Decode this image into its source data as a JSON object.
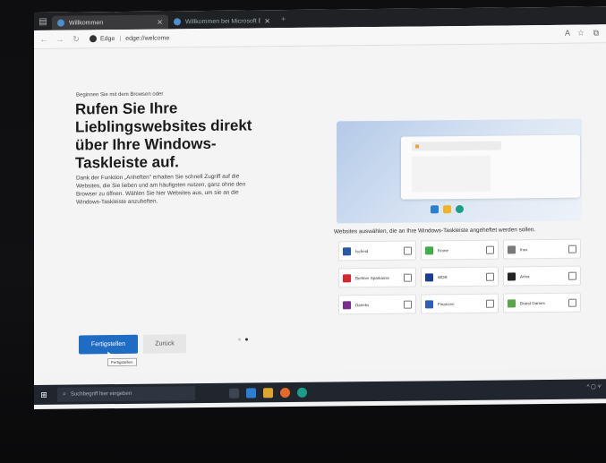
{
  "browser": {
    "tabs": [
      {
        "title": "Willkommen",
        "active": true
      },
      {
        "title": "Willkommen bei Microsoft Edge",
        "active": false
      }
    ],
    "address": {
      "label": "Edge",
      "url": "edge://welcome"
    }
  },
  "page": {
    "kicker": "Beginnen Sie mit dem Browsen oder",
    "heading": "Rufen Sie Ihre Lieblingswebsites direkt über Ihre Windows-Taskleiste auf.",
    "description": "Dank der Funktion „Anheften\" erhalten Sie schnell Zugriff auf die Websites, die Sie lieben und am häufigsten nutzen, ganz ohne den Browser zu öffnen. Wählen Sie hier Websites aus, um sie an die Windows-Taskleiste anzuheften.",
    "sites_title": "Websites auswählen, die an Ihre Windows-Taskleiste angeheftet werden sollen.",
    "sites": [
      {
        "name": "Ischeid",
        "color": "#2a56a8"
      },
      {
        "name": "Krone",
        "color": "#3fae49"
      },
      {
        "name": "Inux",
        "color": "#7a7a7a"
      },
      {
        "name": "Berliner Sparkasse",
        "color": "#d8262d"
      },
      {
        "name": "WDR",
        "color": "#1a3d8f"
      },
      {
        "name": "Arina",
        "color": "#222222"
      },
      {
        "name": "Daneks",
        "color": "#7a2d8c"
      },
      {
        "name": "Finanzen",
        "color": "#2c5fb5"
      },
      {
        "name": "Brand Games",
        "color": "#5aa64a"
      }
    ],
    "finish_label": "Fertigstellen",
    "back_label": "Zurück",
    "tooltip": "Fertigstellen",
    "accent": "#1f6cc4"
  },
  "taskbar": {
    "search_placeholder": "Suchbegriff hier eingeben",
    "tray_text": "^ ▢ ⁴⁄"
  }
}
